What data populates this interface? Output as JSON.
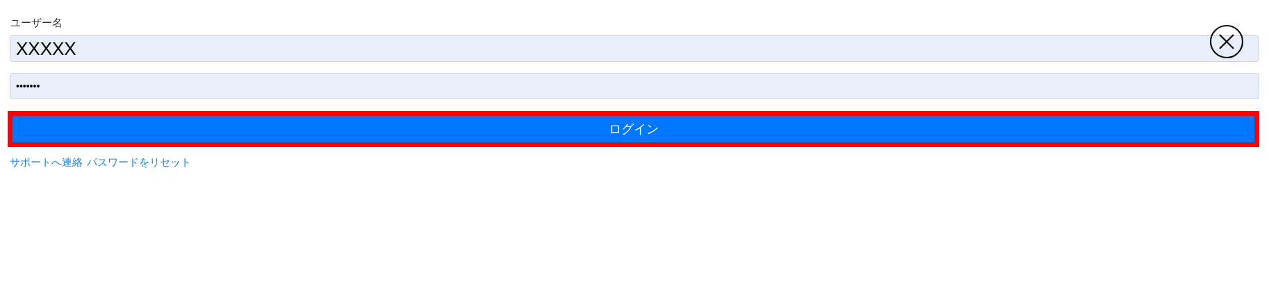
{
  "username": {
    "label": "ユーザー名",
    "value": "XXXXX"
  },
  "password": {
    "value": "•••••••"
  },
  "login_button": {
    "label": "ログイン",
    "highlighted": true
  },
  "links": [
    "サポートへ連絡",
    "パスワードをリセット"
  ],
  "close_button": {
    "visible": true
  }
}
